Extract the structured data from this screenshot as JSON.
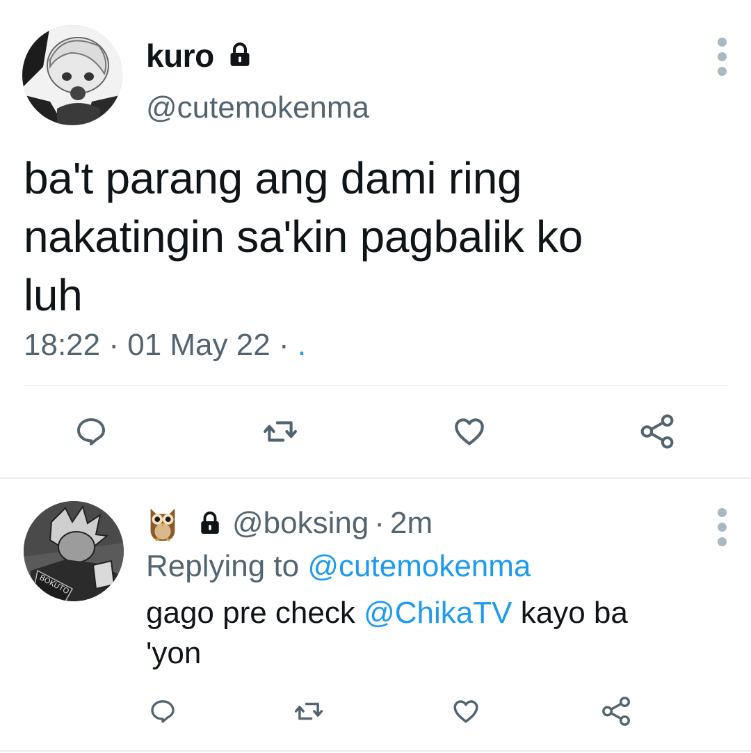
{
  "tweet": {
    "display_name": "kuro",
    "handle": "@cutemokenma",
    "text": "ba't parang ang dami ring\nnakatingin sa'kin pagbalik ko\nluh",
    "time": "18:22",
    "date": "01 May 22",
    "separator": "·",
    "source": ".",
    "lock_icon": "lock-icon",
    "more_icon": "more-vertical-icon",
    "actions": {
      "reply_icon": "reply-icon",
      "retweet_icon": "retweet-icon",
      "like_icon": "heart-icon",
      "share_icon": "share-icon"
    }
  },
  "reply": {
    "display_name_icon": "owl-emoji",
    "handle": "@boksing",
    "separator": "·",
    "time_ago": "2m",
    "replying_prefix": "Replying to",
    "replying_to": "@cutemokenma",
    "text_before": "gago pre check",
    "mention": "@ChikaTV",
    "text_after": "kayo ba\n'yon"
  },
  "colors": {
    "text": "#0f1419",
    "secondary": "#536471",
    "link": "#1d9bf0",
    "icon": "#536471"
  }
}
